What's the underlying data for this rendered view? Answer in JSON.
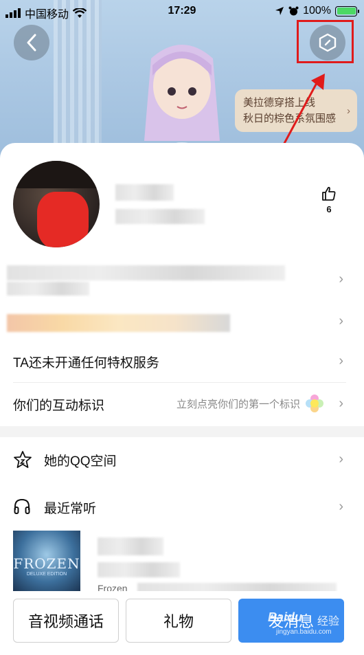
{
  "status_bar": {
    "carrier": "中国移动",
    "time": "17:29",
    "battery": "100%"
  },
  "banner": {
    "outfit_promo_line1": "美拉德穿搭上线",
    "outfit_promo_line2": "秋日的棕色系氛围感"
  },
  "profile": {
    "like_count": "6"
  },
  "rows": {
    "privilege": "TA还未开通任何特权服务",
    "interaction_label": "你们的互动标识",
    "interaction_hint": "立刻点亮你们的第一个标识",
    "qzone": "她的QQ空间",
    "recent_music": "最近常听",
    "album_title": "FROZEN",
    "album_sub": "DELUXE EDITION",
    "song_partial": "Frozen"
  },
  "actions": {
    "call": "音视频通话",
    "gift": "礼物",
    "message": "发消息"
  },
  "watermark": {
    "brand": "Baidu",
    "label": "经验",
    "url": "jingyan.baidu.com"
  },
  "colors": {
    "accent": "#3c8df0",
    "highlight": "#e01b1b"
  }
}
